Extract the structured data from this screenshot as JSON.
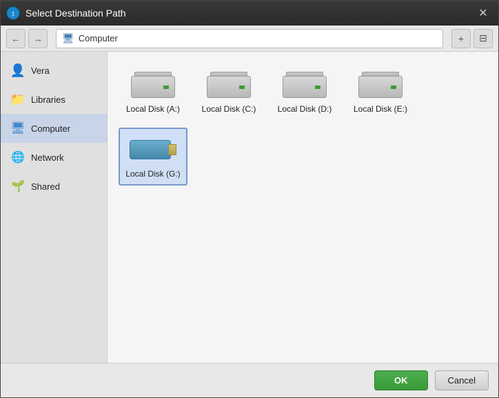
{
  "dialog": {
    "title": "Select Destination Path",
    "close_label": "✕"
  },
  "toolbar": {
    "back_label": "←",
    "forward_label": "→",
    "location": "Computer",
    "new_folder_label": "+",
    "view_label": "⊟"
  },
  "sidebar": {
    "items": [
      {
        "id": "vera",
        "label": "Vera",
        "icon": "person"
      },
      {
        "id": "libraries",
        "label": "Libraries",
        "icon": "library"
      },
      {
        "id": "computer",
        "label": "Computer",
        "icon": "computer",
        "active": true
      },
      {
        "id": "network",
        "label": "Network",
        "icon": "network"
      },
      {
        "id": "shared",
        "label": "Shared",
        "icon": "share"
      }
    ]
  },
  "disks": [
    {
      "id": "disk-a",
      "label": "Local Disk (A:)",
      "type": "hdd",
      "selected": false
    },
    {
      "id": "disk-c",
      "label": "Local Disk (C:)",
      "type": "hdd",
      "selected": false
    },
    {
      "id": "disk-d",
      "label": "Local Disk (D:)",
      "type": "hdd",
      "selected": false
    },
    {
      "id": "disk-e",
      "label": "Local Disk (E:)",
      "type": "hdd",
      "selected": false
    },
    {
      "id": "disk-g",
      "label": "Local Disk (G:)",
      "type": "usb",
      "selected": true
    }
  ],
  "footer": {
    "ok_label": "OK",
    "cancel_label": "Cancel"
  }
}
